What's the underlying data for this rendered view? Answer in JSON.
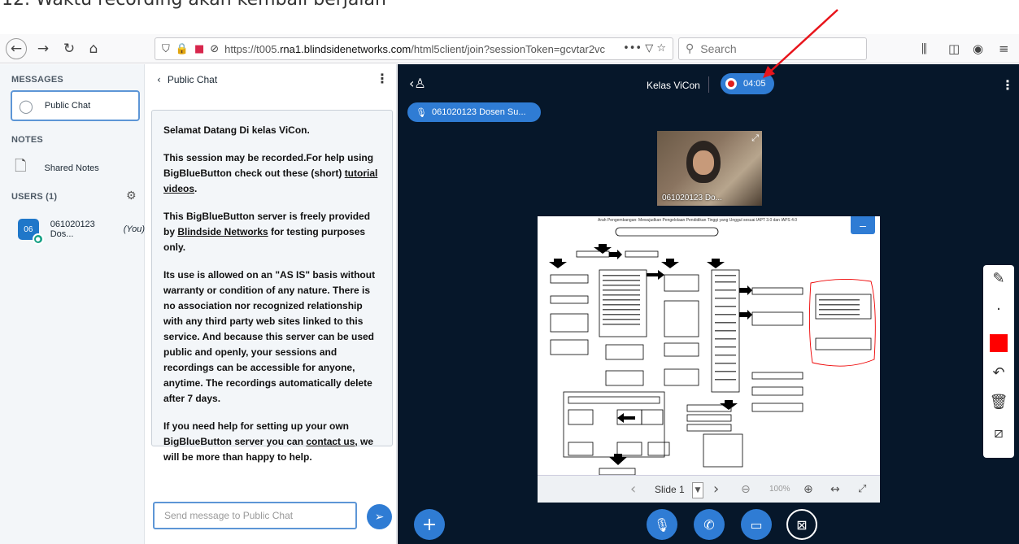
{
  "caption": "12. Waktu recording akan kembali berjalan",
  "browser": {
    "url_prefix": "https://t005.",
    "url_host": "rna1.blindsidenetworks.com",
    "url_path": "/html5client/join?sessionToken=gcvtar2vc",
    "search_placeholder": "Search"
  },
  "userlist": {
    "messages_title": "MESSAGES",
    "public_chat_label": "Public Chat",
    "notes_title": "NOTES",
    "shared_notes_label": "Shared Notes",
    "users_title": "USERS (1)",
    "user_avatar": "06",
    "user_name": "061020123 Dos...",
    "user_you": "(You)"
  },
  "chat": {
    "header": "Public Chat",
    "welcome_title": "Selamat Datang Di kelas ViCon.",
    "para1_before": "This session may be recorded.For help using BigBlueButton check out these (short) ",
    "para1_link": "tutorial videos",
    "para1_after": ".",
    "para2_before": "This BigBlueButton server is freely provided by ",
    "para2_link": "Blindside Networks",
    "para2_after": " for testing purposes only.",
    "para3": "Its use is allowed on an \"AS IS\" basis without warranty or condition of any nature. There is no association nor recognized relationship with any third party web sites linked to this service. And because this server can be used public and openly, your sessions and recordings can be accessible for anyone, anytime. The recordings automatically delete after 7 days.",
    "para4_before": "If you need help for setting up your own BigBlueButton server you can ",
    "para4_link": "contact us",
    "para4_after": ", we will be more than happy to help.",
    "input_placeholder": "Send message to Public Chat"
  },
  "main": {
    "title": "Kelas ViCon",
    "recording_time": "04:05",
    "talker": "061020123 Dosen Su...",
    "webcam_label": "061020123 Do...",
    "slide_label": "Slide 1",
    "zoom": "100%",
    "slide_heading": "Arah Pengembangan: Mewujudkan Pengelolaan Pendidikan Tinggi yang Unggul sesuai IAPT 3.0 dan IAPS 4.0"
  },
  "colors": {
    "accent": "#2f7cd4",
    "main_bg": "#06172a",
    "record_dot": "#e02020",
    "annotation_arrow": "#e8141b",
    "pen_color": "#ff0000"
  }
}
